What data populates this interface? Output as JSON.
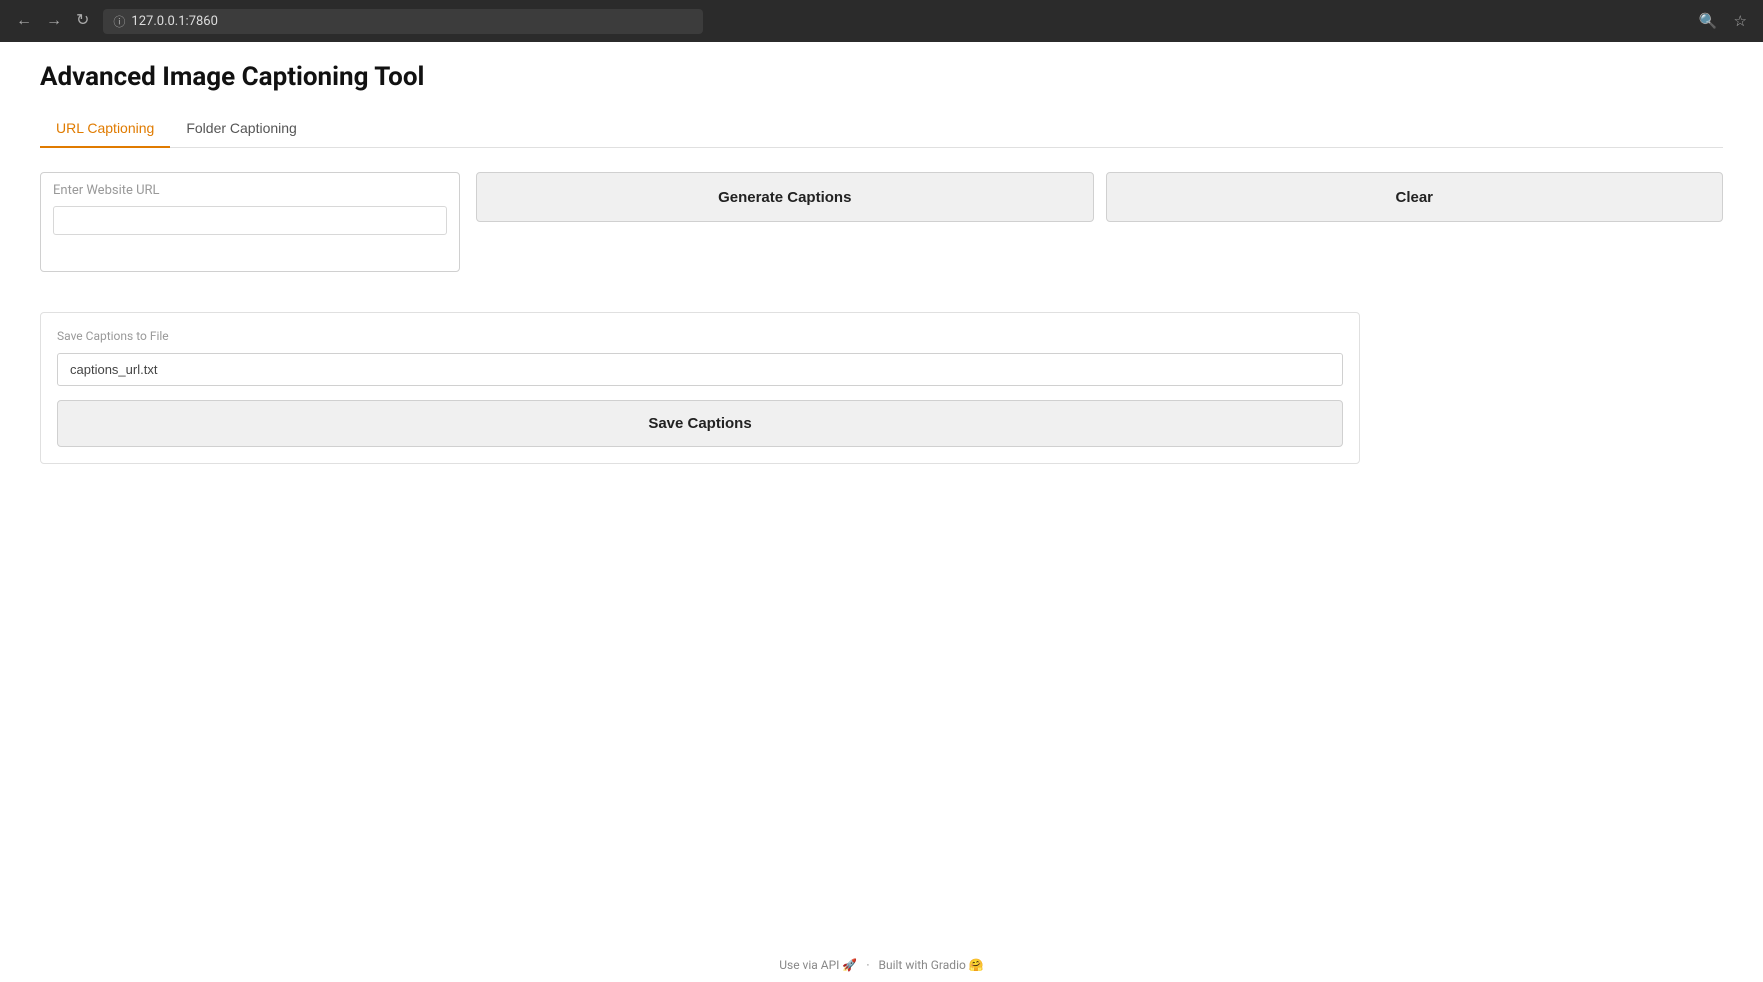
{
  "browser": {
    "url": "127.0.0.1:7860",
    "back_label": "←",
    "forward_label": "→",
    "refresh_label": "↻",
    "zoom_icon": "🔍",
    "star_icon": "☆"
  },
  "page": {
    "title": "Advanced Image Captioning Tool",
    "tabs": [
      {
        "id": "url-captioning",
        "label": "URL Captioning",
        "active": true
      },
      {
        "id": "folder-captioning",
        "label": "Folder Captioning",
        "active": false
      }
    ],
    "url_section": {
      "input_label": "Enter Website URL",
      "input_placeholder": "",
      "input_value": "",
      "generate_button": "Generate Captions",
      "clear_button": "Clear"
    },
    "save_section": {
      "label": "Save Captions to File",
      "input_value": "captions_url.txt",
      "save_button": "Save Captions"
    },
    "footer": {
      "api_text": "Use via API",
      "separator": "·",
      "built_text": "Built with Gradio",
      "api_emoji": "🚀",
      "gradio_emoji": "🤗"
    }
  }
}
